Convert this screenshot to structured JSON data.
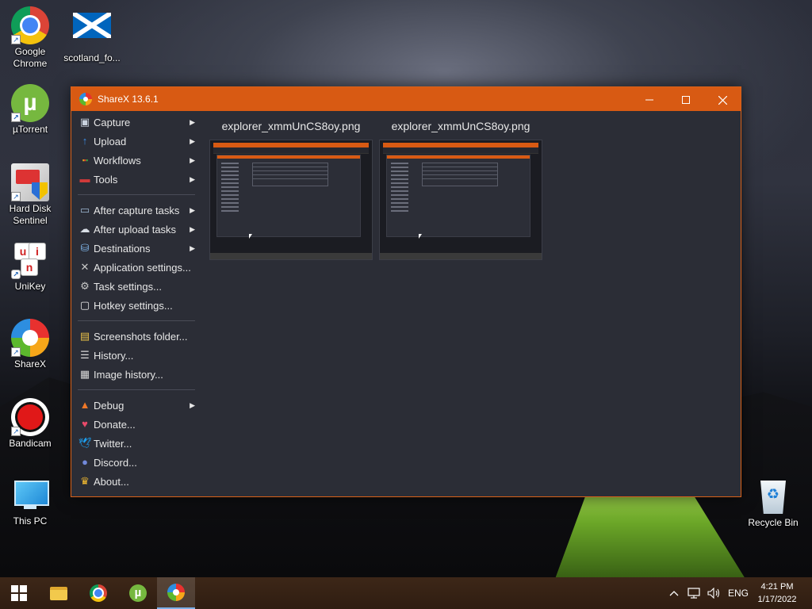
{
  "desktop": {
    "icons": [
      {
        "label": "Google Chrome",
        "icon": "chrome-icon"
      },
      {
        "label": "scotland_fo...",
        "icon": "scotland-flag-icon"
      },
      {
        "label": "µTorrent",
        "icon": "utorrent-icon"
      },
      {
        "label": "Hard Disk Sentinel",
        "icon": "hard-disk-sentinel-icon"
      },
      {
        "label": "UniKey",
        "icon": "unikey-icon"
      },
      {
        "label": "ShareX",
        "icon": "sharex-icon"
      },
      {
        "label": "Bandicam",
        "icon": "bandicam-icon"
      },
      {
        "label": "This PC",
        "icon": "this-pc-icon"
      },
      {
        "label": "Recycle Bin",
        "icon": "recycle-bin-icon"
      }
    ],
    "unikey_letters": [
      "u",
      "i",
      "n"
    ]
  },
  "window": {
    "title": "ShareX 13.6.1",
    "accent": "#d85a13",
    "background": "#2b2d36",
    "controls": {
      "minimize": "minimize-icon",
      "maximize": "maximize-icon",
      "close": "close-icon"
    }
  },
  "menu": {
    "group1": [
      {
        "label": "Capture",
        "icon": "capture-icon",
        "submenu": true
      },
      {
        "label": "Upload",
        "icon": "upload-arrow-icon",
        "submenu": true
      },
      {
        "label": "Workflows",
        "icon": "workflows-grid-icon",
        "submenu": true
      },
      {
        "label": "Tools",
        "icon": "toolbox-icon",
        "submenu": true
      }
    ],
    "group2": [
      {
        "label": "After capture tasks",
        "icon": "after-capture-icon",
        "submenu": true
      },
      {
        "label": "After upload tasks",
        "icon": "cloud-upload-icon",
        "submenu": true
      },
      {
        "label": "Destinations",
        "icon": "destinations-icon",
        "submenu": true
      },
      {
        "label": "Application settings...",
        "icon": "wrench-icon",
        "submenu": false
      },
      {
        "label": "Task settings...",
        "icon": "gear-icon",
        "submenu": false
      },
      {
        "label": "Hotkey settings...",
        "icon": "keyboard-key-icon",
        "submenu": false
      }
    ],
    "group3": [
      {
        "label": "Screenshots folder...",
        "icon": "folder-icon",
        "submenu": false
      },
      {
        "label": "History...",
        "icon": "history-icon",
        "submenu": false
      },
      {
        "label": "Image history...",
        "icon": "image-history-icon",
        "submenu": false
      }
    ],
    "group4": [
      {
        "label": "Debug",
        "icon": "traffic-cone-icon",
        "submenu": true
      },
      {
        "label": "Donate...",
        "icon": "heart-icon",
        "submenu": false
      },
      {
        "label": "Twitter...",
        "icon": "twitter-bird-icon",
        "submenu": false
      },
      {
        "label": "Discord...",
        "icon": "discord-icon",
        "submenu": false
      },
      {
        "label": "About...",
        "icon": "crown-icon",
        "submenu": false
      }
    ]
  },
  "thumbnails": [
    {
      "filename": "explorer_xmmUnCS8oy.png"
    },
    {
      "filename": "explorer_xmmUnCS8oy.png"
    }
  ],
  "taskbar": {
    "buttons": [
      {
        "name": "start",
        "icon": "windows-logo-icon"
      },
      {
        "name": "file-explorer",
        "icon": "folder-icon"
      },
      {
        "name": "chrome",
        "icon": "chrome-icon"
      },
      {
        "name": "utorrent",
        "icon": "utorrent-icon"
      },
      {
        "name": "sharex",
        "icon": "sharex-icon",
        "active": true
      }
    ],
    "tray": {
      "language": "ENG",
      "time": "4:21 PM",
      "date": "1/17/2022"
    }
  }
}
